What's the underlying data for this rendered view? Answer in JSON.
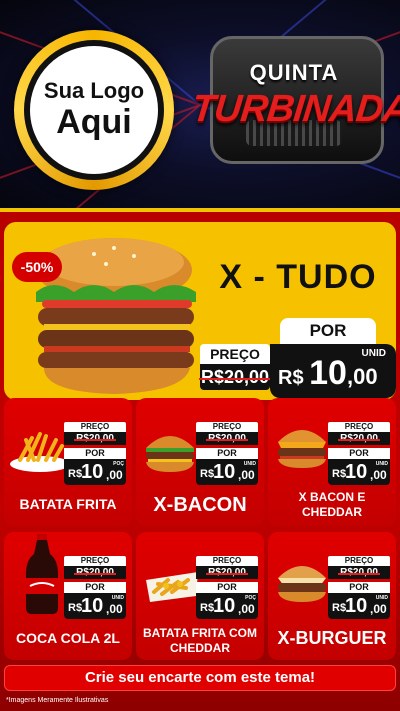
{
  "header": {
    "logo_line1": "Sua Logo",
    "logo_line2": "Aqui",
    "badge_line1": "QUINTA",
    "badge_line2": "TURBINADA"
  },
  "hero": {
    "discount": "-50%",
    "name": "X - TUDO",
    "old_label": "PREÇO",
    "old_price": "R$20,00",
    "new_label": "POR",
    "unit": "UNID",
    "currency": "R$",
    "price_int": "10",
    "price_cents": ",00"
  },
  "cards": [
    {
      "name": "BATATA FRITA",
      "preco_label": "PREÇO",
      "old_price": "R$20,00",
      "por_label": "POR",
      "currency": "R$",
      "price_int": "10",
      "price_cents": ",00",
      "unit": "POÇ"
    },
    {
      "name": "X-BACON",
      "preco_label": "PREÇO",
      "old_price": "R$20,00",
      "por_label": "POR",
      "currency": "R$",
      "price_int": "10",
      "price_cents": ",00",
      "unit": "UNID"
    },
    {
      "name": "X BACON E CHEDDAR",
      "preco_label": "PREÇO",
      "old_price": "R$20,00",
      "por_label": "POR",
      "currency": "R$",
      "price_int": "10",
      "price_cents": ",00",
      "unit": "UNID"
    },
    {
      "name": "COCA COLA 2L",
      "preco_label": "PREÇO",
      "old_price": "R$20,00",
      "por_label": "POR",
      "currency": "R$",
      "price_int": "10",
      "price_cents": ",00",
      "unit": "UNID"
    },
    {
      "name": "BATATA FRITA COM CHEDDAR",
      "preco_label": "PREÇO",
      "old_price": "R$20,00",
      "por_label": "POR",
      "currency": "R$",
      "price_int": "10",
      "price_cents": ",00",
      "unit": "POÇ"
    },
    {
      "name": "X-BURGUER",
      "preco_label": "PREÇO",
      "old_price": "R$20,00",
      "por_label": "POR",
      "currency": "R$",
      "price_int": "10",
      "price_cents": ",00",
      "unit": "UNID"
    }
  ],
  "footer": {
    "cta": "Crie seu encarte com este tema!",
    "disclaimer": "*Imagens Meramente Ilustrativas"
  },
  "colors": {
    "brand_red": "#d40000",
    "brand_yellow": "#f6c200",
    "dark": "#111111"
  },
  "icons": [
    "burger-icon",
    "fries-icon",
    "soda-bottle-icon",
    "cheddar-fries-icon"
  ]
}
